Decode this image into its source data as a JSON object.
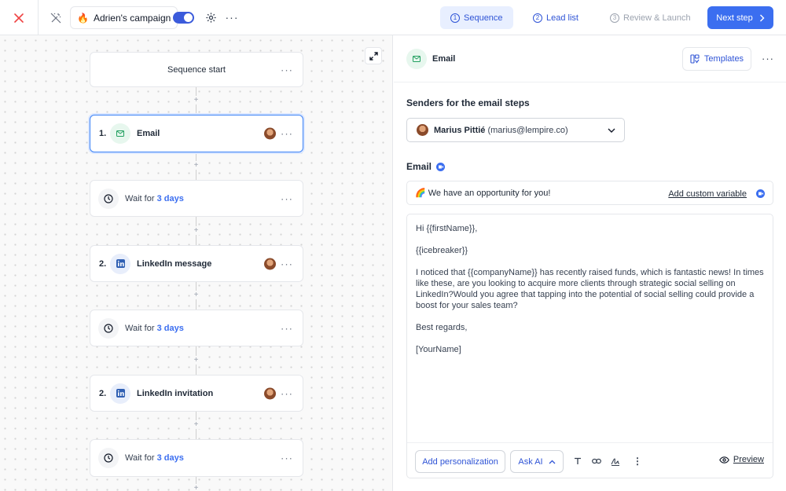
{
  "header": {
    "campaign_icon": "fire-emoji",
    "campaign_emoji": "🔥",
    "campaign_name": "Adrien's campaign",
    "toggle_on": true,
    "steps": [
      {
        "num": "1",
        "label": "Sequence",
        "state": "active"
      },
      {
        "num": "2",
        "label": "Lead list",
        "state": "default"
      },
      {
        "num": "3",
        "label": "Review & Launch",
        "state": "disabled"
      }
    ],
    "next_label": "Next step"
  },
  "sequence": {
    "start_label": "Sequence start",
    "wait_prefix": "Wait for",
    "nodes": [
      {
        "type": "email",
        "num": "1.",
        "title": "Email",
        "icon": "mail-icon"
      },
      {
        "type": "wait",
        "value": "3 days"
      },
      {
        "type": "linkedin",
        "num": "2.",
        "title": "LinkedIn message",
        "icon": "linkedin-icon"
      },
      {
        "type": "wait",
        "value": "3 days"
      },
      {
        "type": "linkedin",
        "num": "2.",
        "title": "LinkedIn invitation",
        "icon": "linkedin-icon"
      },
      {
        "type": "wait",
        "value": "3 days"
      }
    ]
  },
  "panel": {
    "title": "Email",
    "templates_label": "Templates",
    "senders_title": "Senders for the email steps",
    "sender_name": "Marius Pittié",
    "sender_email": "(marius@lempire.co)",
    "email_label": "Email",
    "subject": "🌈 We have an opportunity for you!",
    "add_variable": "Add custom variable",
    "body": {
      "greeting": "Hi {{firstName}},",
      "icebreaker": "{{icebreaker}}",
      "paragraph": "I noticed that {{companyName}} has recently raised funds, which is fantastic news! In times like these, are you looking to acquire more clients through strategic social selling on LinkedIn?Would you agree that tapping into the potential of social selling could provide a boost for your sales team?",
      "signoff": "Best regards,",
      "name": "[YourName]"
    },
    "toolbar": {
      "personalization": "Add personalization",
      "ask_ai": "Ask AI",
      "preview": "Preview"
    }
  },
  "colors": {
    "accent": "#3b6ef0",
    "close": "#ef4444",
    "mail_green": "#22a060",
    "linkedin": "#2f5fb3"
  }
}
